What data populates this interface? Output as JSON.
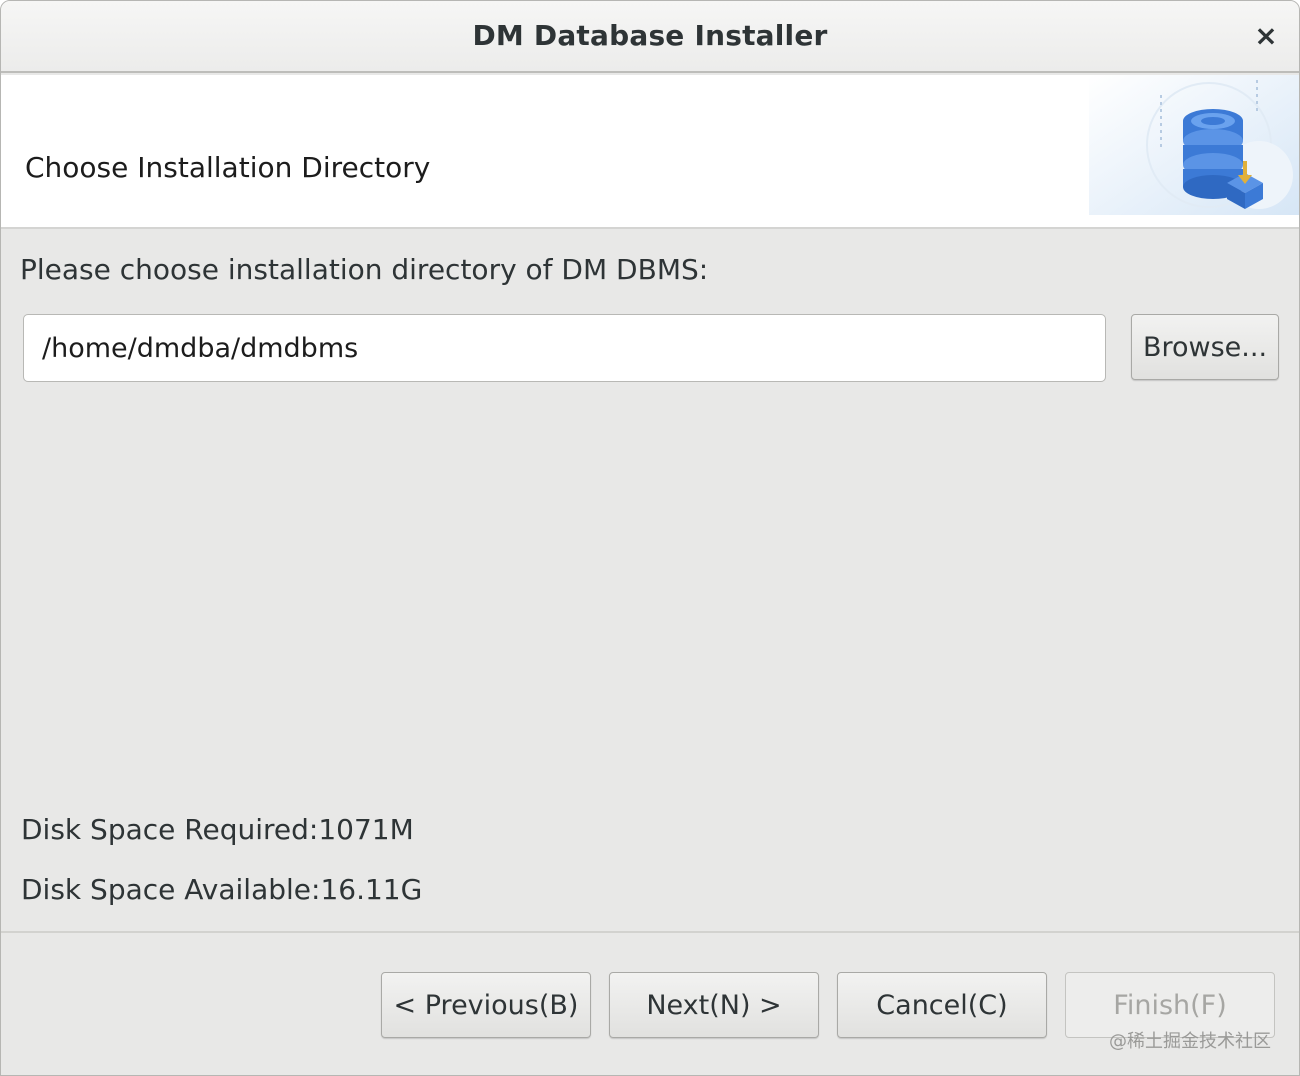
{
  "window": {
    "title": "DM Database Installer",
    "close_glyph": "×"
  },
  "banner": {
    "heading": "Choose Installation Directory",
    "art_icon": "database-install-icon",
    "accent": "#3a78d8"
  },
  "content": {
    "prompt": "Please choose installation directory of DM DBMS:",
    "path_value": "/home/dmdba/dmdbms",
    "browse_label": "Browse...",
    "disk_required": "Disk Space Required:1071M",
    "disk_available": "Disk Space Available:16.11G"
  },
  "footer": {
    "previous_label": "< Previous(B)",
    "next_label": "Next(N) >",
    "cancel_label": "Cancel(C)",
    "finish_label": "Finish(F)",
    "watermark": "@稀土掘金技术社区"
  }
}
